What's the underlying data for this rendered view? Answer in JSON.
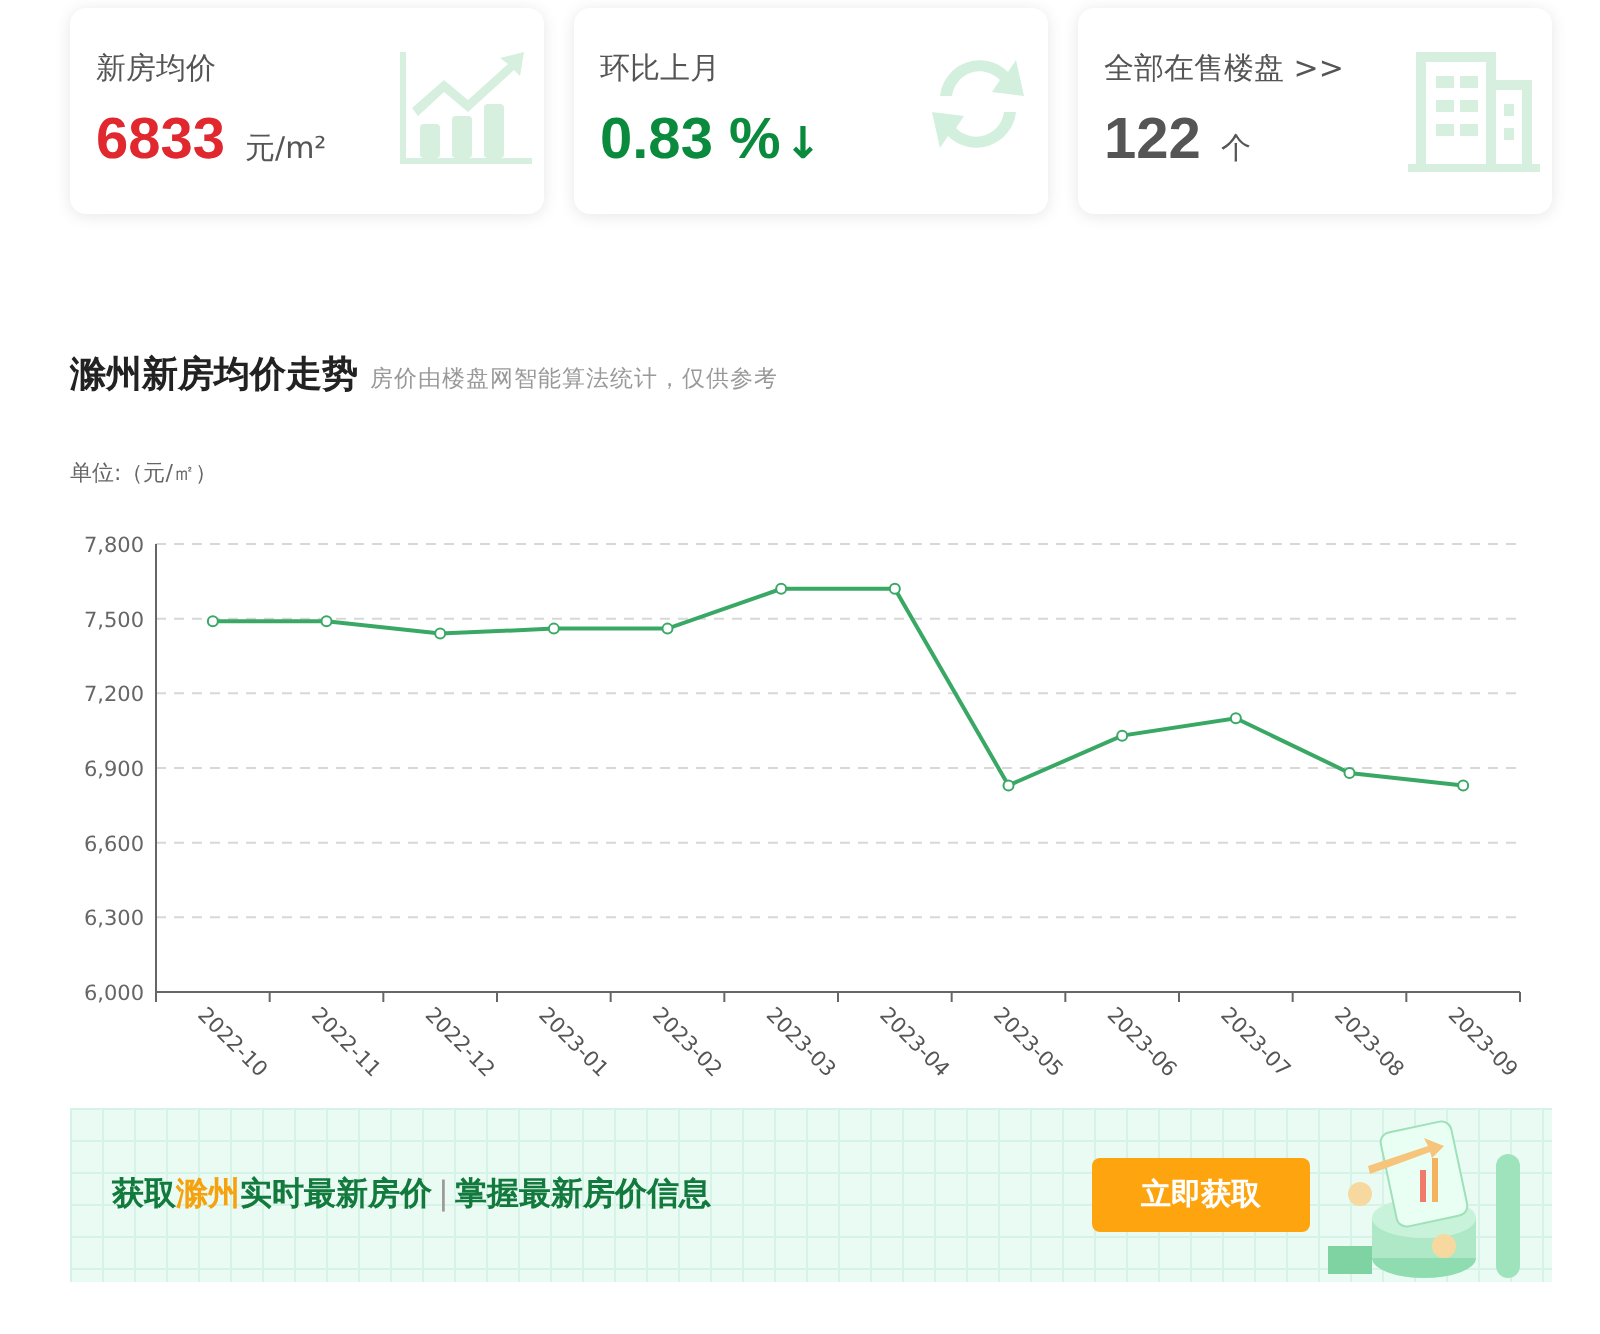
{
  "stats": [
    {
      "kind": "price",
      "label": "新房均价",
      "value": "6833",
      "unit": "元/m²"
    },
    {
      "kind": "change",
      "label": "环比上月",
      "value": "0.83 %",
      "arrow": "↓"
    },
    {
      "kind": "count",
      "label": "全部在售楼盘 >>",
      "value": "122",
      "unit": "个"
    }
  ],
  "trend": {
    "title": "滁州新房均价走势",
    "note": "房价由楼盘网智能算法统计，仅供参考",
    "unit_label": "单位:（元/㎡）",
    "chart_data": {
      "type": "line",
      "categories": [
        "2022-10",
        "2022-11",
        "2022-12",
        "2023-01",
        "2023-02",
        "2023-03",
        "2023-04",
        "2023-05",
        "2023-06",
        "2023-07",
        "2023-08",
        "2023-09"
      ],
      "grid": true,
      "series": [
        {
          "color": "#3aa865",
          "marker": true,
          "values": [
            7490,
            7490,
            7440,
            7460,
            7460,
            7620,
            7620,
            6830,
            7030,
            7100,
            6880,
            6830
          ]
        }
      ],
      "ylim": [
        6000,
        7800
      ],
      "yticks": [
        {
          "value": 6000,
          "label": "6,000"
        },
        {
          "value": 6300,
          "label": "6,300"
        },
        {
          "value": 6600,
          "label": "6,600"
        },
        {
          "value": 6900,
          "label": "6,900"
        },
        {
          "value": 7200,
          "label": "7,200"
        },
        {
          "value": 7500,
          "label": "7,500"
        },
        {
          "value": 7800,
          "label": "7,800"
        }
      ]
    }
  },
  "banner": {
    "segments": [
      {
        "text": "获取",
        "highlight": false
      },
      {
        "text": "滁州",
        "highlight": true
      },
      {
        "text": "实时最新房价",
        "highlight": false
      }
    ],
    "separator": "|",
    "tagline": "掌握最新房价信息",
    "button": "立即获取"
  }
}
